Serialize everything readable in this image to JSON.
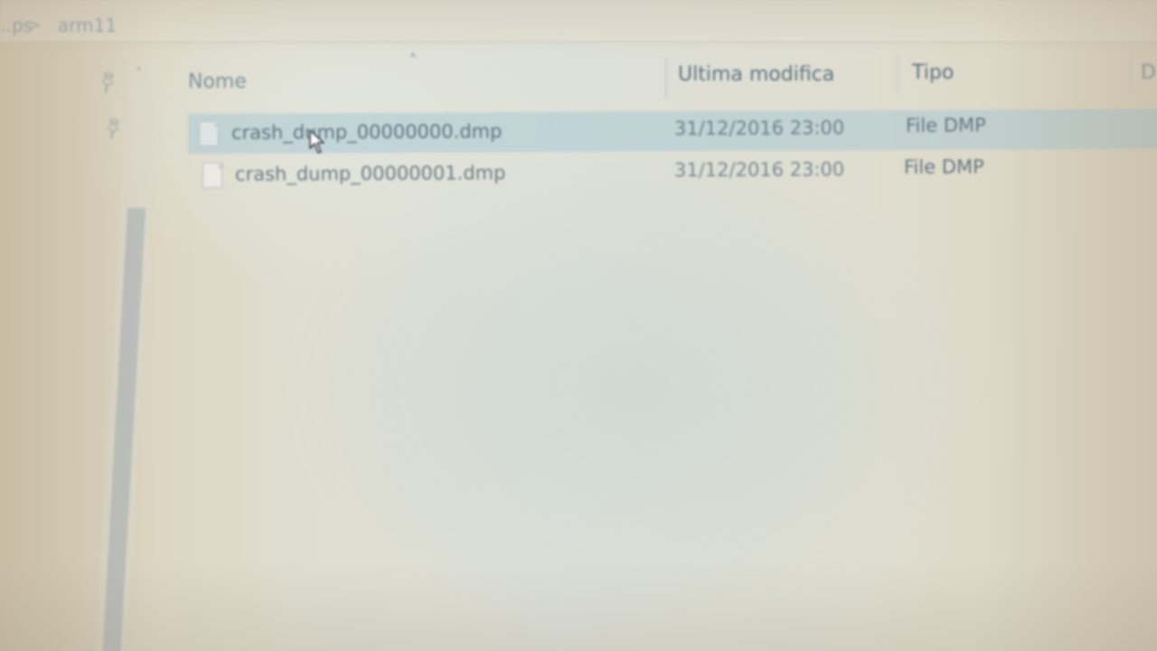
{
  "breadcrumb": {
    "prev": "...ps",
    "separator": ">",
    "current": "arm11"
  },
  "columns": {
    "name": "Nome",
    "modified": "Ultima modifica",
    "type": "Tipo",
    "extra": "D"
  },
  "files": [
    {
      "name": "crash_dump_00000000.dmp",
      "modified": "31/12/2016 23:00",
      "type": "File DMP",
      "selected": true
    },
    {
      "name": "crash_dump_00000001.dmp",
      "modified": "31/12/2016 23:00",
      "type": "File DMP",
      "selected": false
    }
  ],
  "icons": {
    "pin": "pin-icon",
    "sort": "sort-ascending-icon",
    "file": "file-icon",
    "scroll_up": "scroll-up-arrow-icon",
    "cursor": "mouse-cursor-icon"
  },
  "colors": {
    "selection": "#aac8d4",
    "text": "#61737f"
  }
}
